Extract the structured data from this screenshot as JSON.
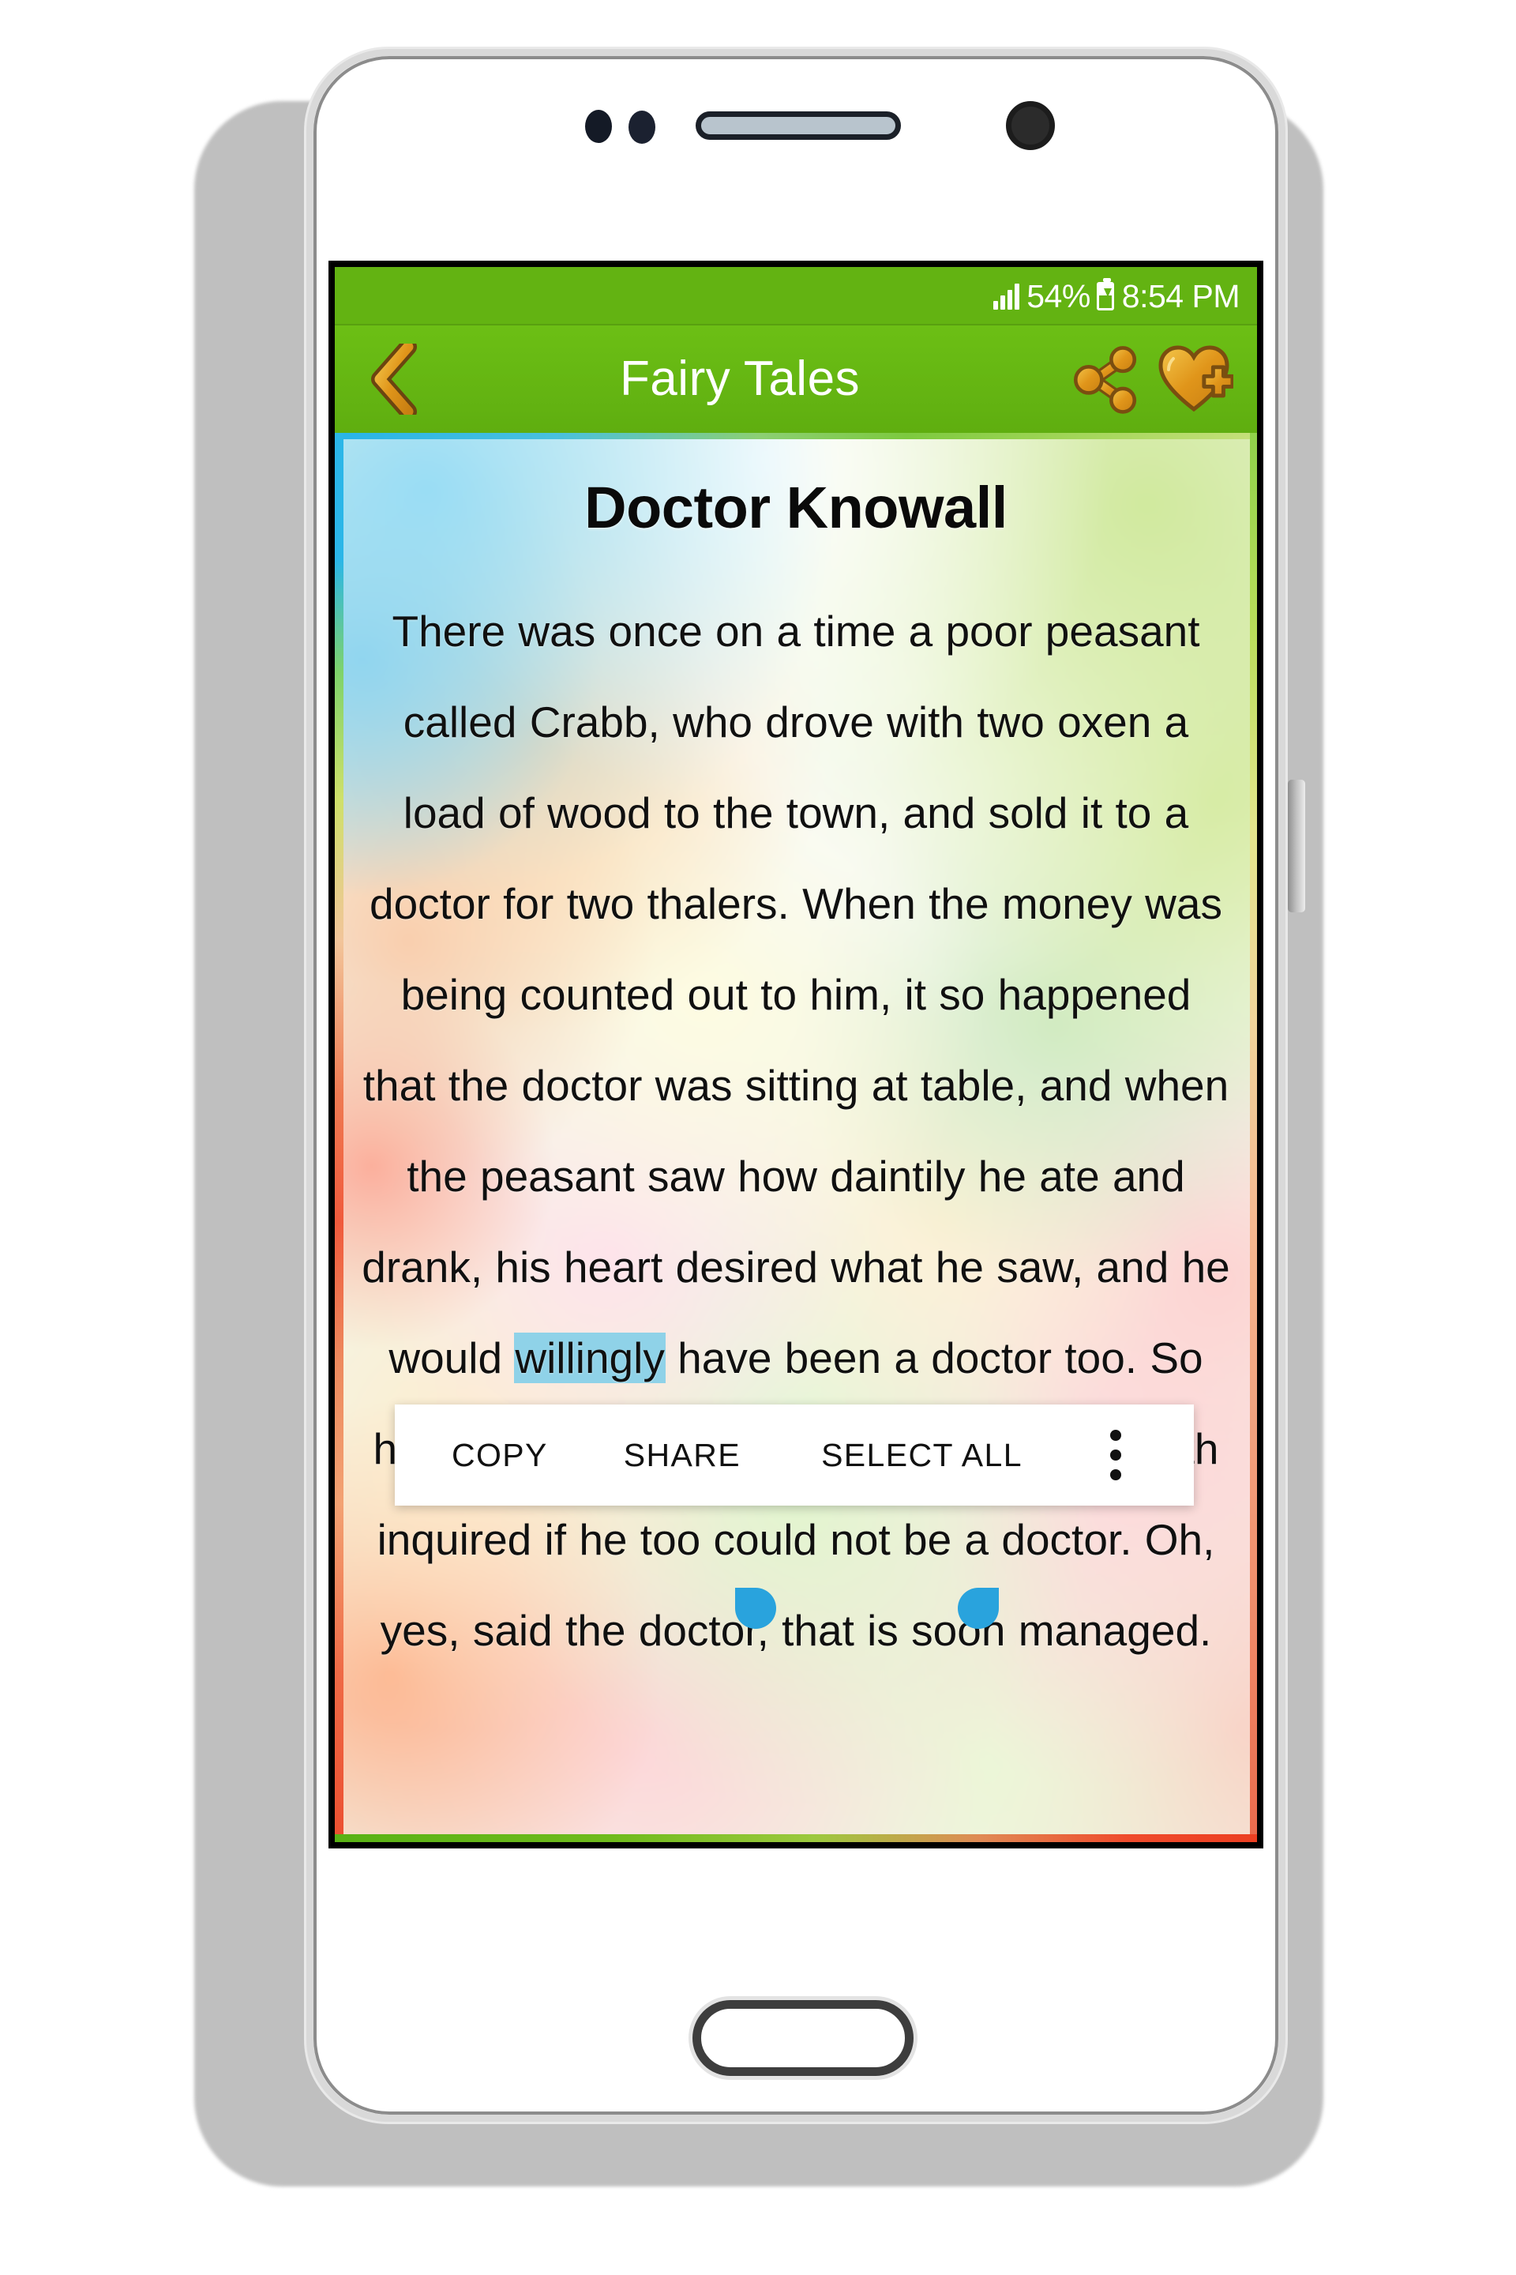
{
  "device": {
    "hardware": {
      "sensor_1": "proximity-sensor",
      "sensor_2": "light-sensor",
      "earpiece": "earpiece-speaker",
      "front_camera": "front-camera",
      "home_button": "home-button",
      "side_button": "power-button"
    }
  },
  "status_bar": {
    "signal_icon": "signal-bars-icon",
    "battery_percent": "54%",
    "battery_icon": "battery-charging-icon",
    "time": "8:54 PM",
    "background_color": "#63b312"
  },
  "app_bar": {
    "back_icon": "back-chevron-icon",
    "title": "Fairy Tales",
    "share_icon": "share-icon",
    "favorite_icon": "heart-plus-icon",
    "background_color": "#6cbf15",
    "icon_color": "#e8a317"
  },
  "story": {
    "title": "Doctor Knowall",
    "paragraph_before_selection": "There was once on a time a poor peasant called Crabb, who drove with two oxen a load of wood to the town, and sold it to a doctor for two thalers. When the money was being counted out to him, it so happened that the doctor was sitting at table, and when the peasant saw how daintily he ate and drank, his heart desired what he saw, and he would ",
    "selected_text": "willingly",
    "paragraph_after_selection": " have been a doctor too. So he remained standing a while, and at length inquired if he too could not be a doctor. Oh, yes, said the doctor, that is soon managed.",
    "selection_color": "#8fd2e8",
    "handle_color": "#29a3dd"
  },
  "context_menu": {
    "copy_label": "COPY",
    "share_label": "SHARE",
    "select_all_label": "SELECT ALL",
    "overflow_icon": "more-vertical-icon"
  }
}
